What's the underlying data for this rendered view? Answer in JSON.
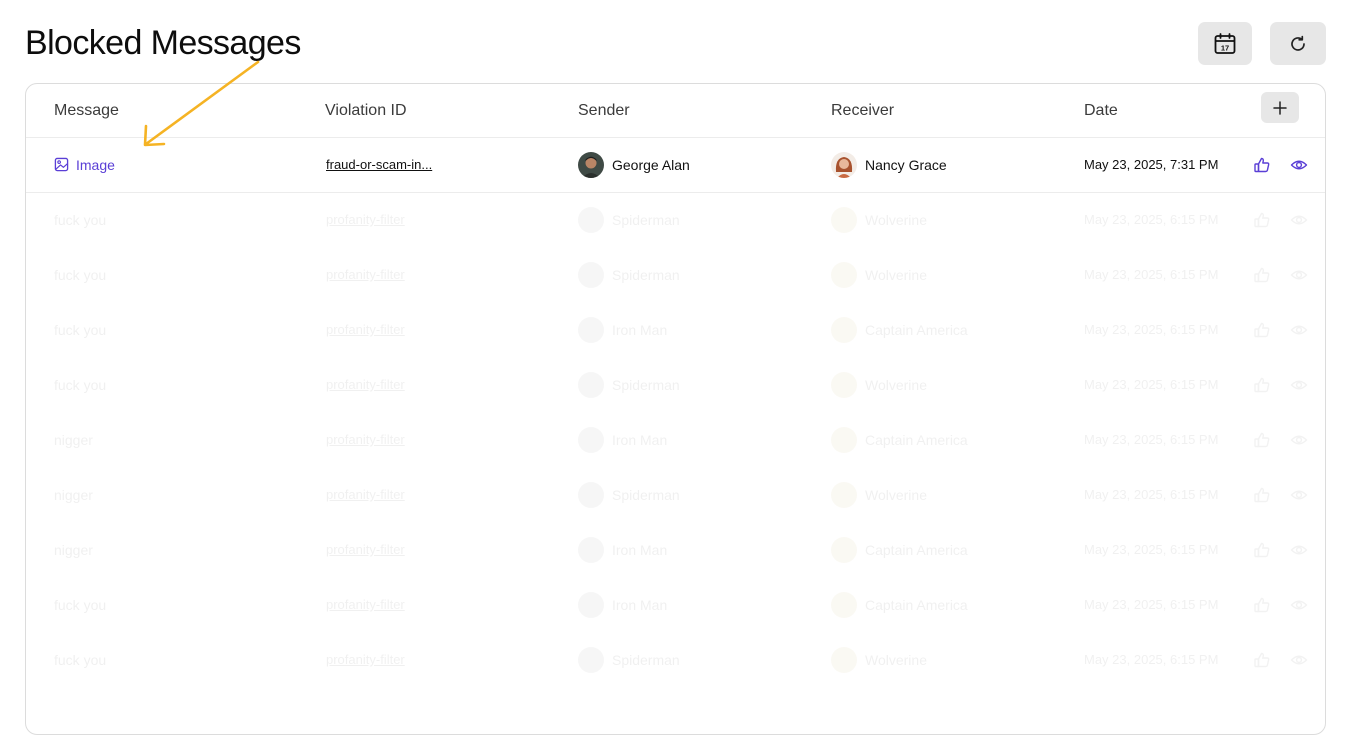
{
  "page": {
    "title": "Blocked Messages"
  },
  "toolbar": {
    "calendar_icon": "calendar-icon",
    "refresh_icon": "refresh-icon",
    "calendar_day": "17"
  },
  "table": {
    "columns": [
      "Message",
      "Violation ID",
      "Sender",
      "Receiver",
      "Date"
    ],
    "add_icon": "plus-icon",
    "rows": [
      {
        "message": "Image",
        "violation": "fraud-or-scam-in...",
        "sender": "George Alan",
        "receiver": "Nancy Grace",
        "date": "May 23, 2025, 7:31 PM"
      },
      {
        "message": "fuck you",
        "violation": "profanity-filter",
        "sender": "Spiderman",
        "receiver": "Wolverine",
        "date": "May 23, 2025, 6:15 PM"
      },
      {
        "message": "fuck you",
        "violation": "profanity-filter",
        "sender": "Spiderman",
        "receiver": "Wolverine",
        "date": "May 23, 2025, 6:15 PM"
      },
      {
        "message": "fuck you",
        "violation": "profanity-filter",
        "sender": "Iron Man",
        "receiver": "Captain America",
        "date": "May 23, 2025, 6:15 PM"
      },
      {
        "message": "fuck you",
        "violation": "profanity-filter",
        "sender": "Spiderman",
        "receiver": "Wolverine",
        "date": "May 23, 2025, 6:15 PM"
      },
      {
        "message": "nigger",
        "violation": "profanity-filter",
        "sender": "Iron Man",
        "receiver": "Captain America",
        "date": "May 23, 2025, 6:15 PM"
      },
      {
        "message": "nigger",
        "violation": "profanity-filter",
        "sender": "Spiderman",
        "receiver": "Wolverine",
        "date": "May 23, 2025, 6:15 PM"
      },
      {
        "message": "nigger",
        "violation": "profanity-filter",
        "sender": "Iron Man",
        "receiver": "Captain America",
        "date": "May 23, 2025, 6:15 PM"
      },
      {
        "message": "fuck you",
        "violation": "profanity-filter",
        "sender": "Iron Man",
        "receiver": "Captain America",
        "date": "May 23, 2025, 6:15 PM"
      },
      {
        "message": "fuck you",
        "violation": "profanity-filter",
        "sender": "Spiderman",
        "receiver": "Wolverine",
        "date": "May 23, 2025, 6:15 PM"
      }
    ]
  },
  "colors": {
    "accent": "#5a3fd6",
    "annotation_arrow": "#f5b324",
    "button_bg": "#e7e7e7"
  }
}
